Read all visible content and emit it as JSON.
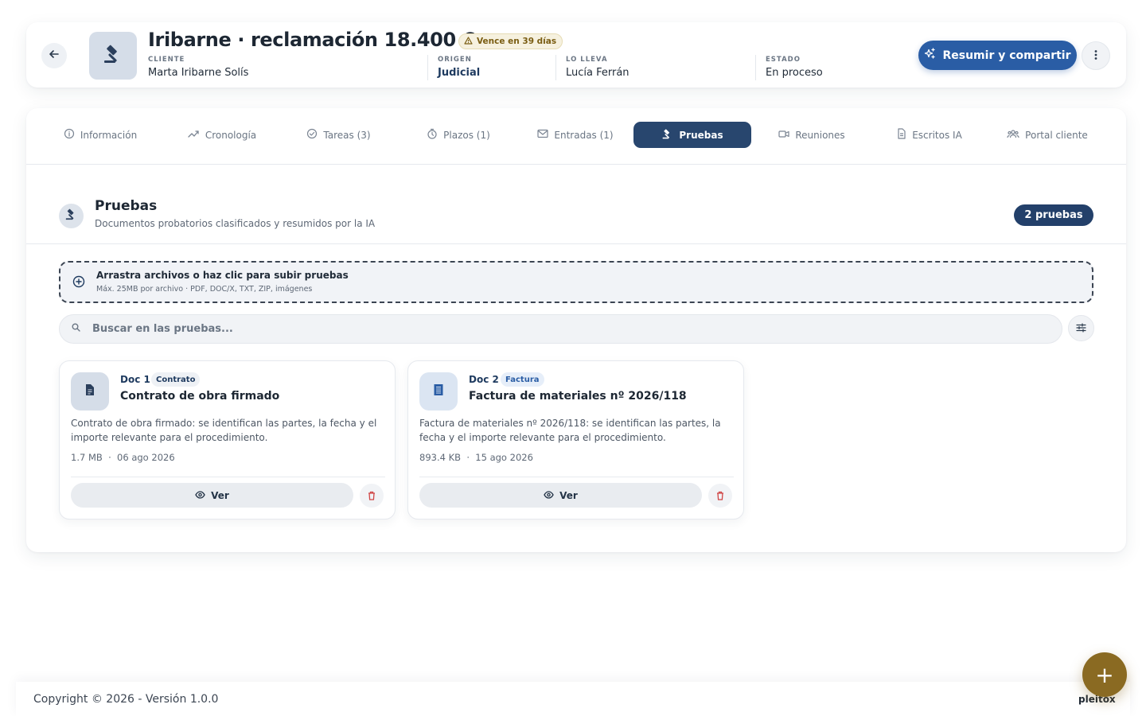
{
  "colors": {
    "primary": "#2a5da5",
    "tab_active": "#28466e",
    "badge_dark": "#23406a",
    "warning_bg": "#f6f1df",
    "danger": "#d04545",
    "fab": "#8a6a22"
  },
  "header": {
    "back_icon": "arrow-left-icon",
    "case_icon": "gavel-icon",
    "title": "Iribarne · reclamación 18.400 €",
    "due_badge": "Vence en 39 días",
    "meta": [
      {
        "label": "CLIENTE",
        "value": "Marta Iribarne Solís"
      },
      {
        "label": "ORIGEN",
        "value": "Judicial"
      },
      {
        "label": "LO LLEVA",
        "value": "Lucía Ferrán"
      },
      {
        "label": "ESTADO",
        "value": "En proceso"
      }
    ],
    "share_button": "Resumir y compartir",
    "more_icon": "more-vertical-icon"
  },
  "tabs": [
    {
      "label": "Información",
      "icon": "info-icon"
    },
    {
      "label": "Cronología",
      "icon": "trend-icon"
    },
    {
      "label": "Tareas (3)",
      "icon": "check-circle-icon"
    },
    {
      "label": "Plazos (1)",
      "icon": "timer-icon"
    },
    {
      "label": "Entradas (1)",
      "icon": "mail-icon"
    },
    {
      "label": "Pruebas",
      "icon": "gavel-icon",
      "active": true
    },
    {
      "label": "Reuniones",
      "icon": "video-icon"
    },
    {
      "label": "Escritos IA",
      "icon": "document-icon"
    },
    {
      "label": "Portal cliente",
      "icon": "users-icon"
    }
  ],
  "section": {
    "title": "Pruebas",
    "subtitle": "Documentos probatorios clasificados y resumidos por la IA",
    "count_badge": "2 pruebas"
  },
  "dropzone": {
    "title": "Arrastra archivos o haz clic para subir pruebas",
    "subtitle": "Máx. 25MB por archivo · PDF, DOC/X, TXT, ZIP, imágenes"
  },
  "search": {
    "placeholder": "Buscar en las pruebas..."
  },
  "documents": [
    {
      "number": "Doc 1",
      "type": "Contrato",
      "name": "Contrato de obra firmado",
      "description": "Contrato de obra firmado: se identifican las partes, la fecha y el importe relevante para el procedimiento.",
      "size": "1.7 MB",
      "date": "06 ago 2026",
      "view_label": "Ver"
    },
    {
      "number": "Doc 2",
      "type": "Factura",
      "name": "Factura de materiales nº 2026/118",
      "description": "Factura de materiales nº 2026/118: se identifican las partes, la fecha y el importe relevante para el procedimiento.",
      "size": "893.4 KB",
      "date": "15 ago 2026",
      "view_label": "Ver"
    }
  ],
  "footer": {
    "copyright": "Copyright © 2026 - Versión 1.0.0",
    "brand": "pleitox"
  },
  "fab_label": "+"
}
